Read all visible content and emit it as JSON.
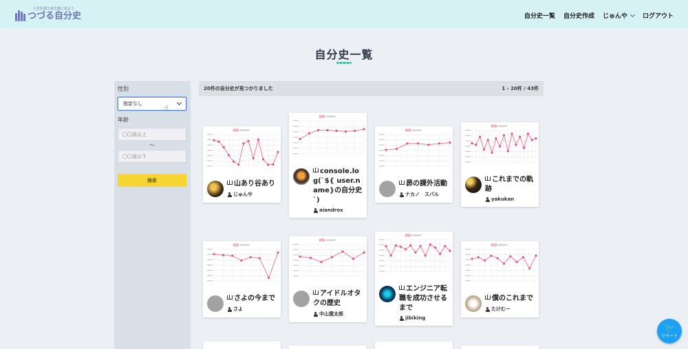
{
  "header": {
    "logo_tagline": "人生を振り返る旅に出よう",
    "logo_name": "つづる自分史",
    "nav": {
      "list": "自分史一覧",
      "create": "自分史作成",
      "user": "じゅんや",
      "logout": "ログアウト"
    }
  },
  "page_title": "自分史一覧",
  "sidebar": {
    "gender_label": "性別",
    "gender_value": "指定なし",
    "age_label": "年齢",
    "age_min_placeholder": "〇〇歳以上",
    "age_separator": "〜",
    "age_max_placeholder": "〇〇歳以下",
    "search_button": "検索"
  },
  "results": {
    "count_text": "20件の自分史が見つかりました",
    "range_text": "1 - 20件 / 43件"
  },
  "cards": [
    {
      "title": "山あり谷あり",
      "user": "じゅんや",
      "avatar": "dark",
      "series": [
        0.82,
        0.78,
        0.6,
        0.35,
        0.15,
        0.05,
        0.72,
        0.8,
        0.25,
        0.84,
        0.22,
        0.05,
        0.06,
        0.45
      ]
    },
    {
      "title": "console.log(`${ user.name}の自分史`)",
      "user": "aiandrox",
      "avatar": "cat",
      "series": [
        0.45,
        0.62,
        0.72,
        0.72,
        0.7,
        0.68,
        0.7,
        0.75
      ]
    },
    {
      "title": "昴の課外活動",
      "user": "ナカノ　スバル",
      "avatar": "grey",
      "series": [
        0.52,
        0.55,
        0.72,
        0.72,
        0.68,
        0.72,
        0.75
      ]
    },
    {
      "title": "これまでの軌跡",
      "user": "yakukan",
      "avatar": "night",
      "series": [
        0.6,
        0.55,
        0.8,
        0.4,
        0.7,
        0.3,
        0.75,
        0.5,
        0.85,
        0.35,
        0.9,
        0.55,
        0.8,
        0.45,
        0.9,
        0.7,
        0.75
      ]
    },
    {
      "title": "さよの今まで",
      "user": "さよ",
      "avatar": "grey",
      "series": [
        0.85,
        0.82,
        0.8,
        0.65,
        0.75,
        0.72,
        0.1,
        0.9
      ]
    },
    {
      "title": "アイドルオタクの歴史",
      "user": "中山遼太郎",
      "avatar": "grey",
      "series": [
        0.62,
        0.58,
        0.45,
        0.6,
        0.78,
        0.55,
        0.75
      ]
    },
    {
      "title": "エンジニア転職を成功させるまで",
      "user": "jibiking",
      "avatar": "blue",
      "series": [
        0.8,
        0.5,
        0.82,
        0.78,
        0.7,
        0.82,
        0.6,
        0.8,
        0.5,
        0.85,
        0.75,
        0.55,
        0.8,
        0.65
      ]
    },
    {
      "title": "僕のこれまで",
      "user": "たけむー",
      "avatar": "cat2",
      "series": [
        0.7,
        0.75,
        0.65,
        0.8,
        0.72,
        0.55,
        0.78,
        0.6,
        0.75,
        0.4,
        0.8
      ]
    }
  ]
}
